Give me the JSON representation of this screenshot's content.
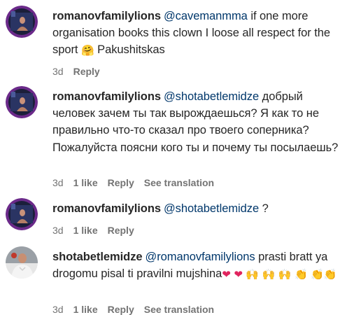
{
  "comments": [
    {
      "username": "romanovfamilylions",
      "mention": "@cavemanmma",
      "text1": " if one more organisation books this clown I loose all respect for the sport ",
      "emoji1": "🤗",
      "text2": " Pakushitskas",
      "time": "3d",
      "reply": "Reply"
    },
    {
      "username": "romanovfamilylions",
      "mention": "@shotabetlemidze",
      "text1": " добрый человек зачем ты так вырождаешься? Я как то не правильно что-то сказал про твоего соперника? Пожалуйста поясни кого ты и почему ты посылаешь?",
      "time": "3d",
      "likes": "1 like",
      "reply": "Reply",
      "translation": "See translation"
    },
    {
      "username": "romanovfamilylions",
      "mention": "@shotabetlemidze",
      "text1": " ?",
      "time": "3d",
      "likes": "1 like",
      "reply": "Reply"
    },
    {
      "username": "shotabetlemidze",
      "mention": "@romanovfamilylions",
      "text1": " prasti bratt ya drogomu pisal ti pravilni mujshina",
      "emojis": [
        "❤",
        "❤",
        "🙌",
        "🙌",
        "🙌",
        "👏",
        "👏",
        "👏"
      ],
      "time": "3d",
      "likes": "1 like",
      "reply": "Reply",
      "translation": "See translation"
    }
  ],
  "icons": {
    "avatar_romanov": "avatar-fighter-photo",
    "avatar_shota": "avatar-fighter-photo-white-shirt"
  },
  "colors": {
    "mention": "#00376b",
    "meta": "#737373",
    "text": "#262626"
  }
}
